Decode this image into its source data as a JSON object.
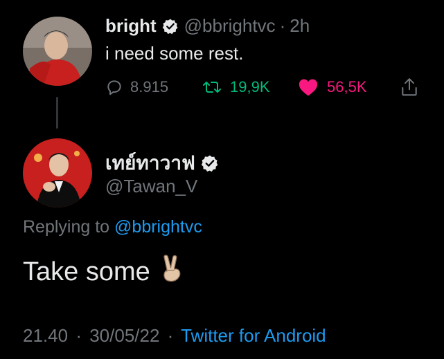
{
  "parent_tweet": {
    "display_name": "bright",
    "handle": "@bbrightvc",
    "separator": "·",
    "time": "2h",
    "text": "i need some rest.",
    "reply_count": "8.915",
    "retweet_count": "19,9K",
    "like_count": "56,5K",
    "avatar_icon": "user-avatar-photo"
  },
  "reply_tweet": {
    "display_name": "เทย์ทาวาฟ",
    "handle": "@Tawan_V",
    "replying_prefix": "Replying to",
    "replying_to": "@bbrightvc",
    "text": "Take some",
    "emoji": "✌🏼",
    "time": "21.40",
    "date_separator": "·",
    "date": "30/05/22",
    "source_separator": "·",
    "source": "Twitter for Android",
    "avatar_icon": "user-avatar-photo"
  },
  "colors": {
    "background": "#000000",
    "text": "#e7e9ea",
    "muted": "#71767b",
    "link": "#1d9bf0",
    "retweet": "#00ba7c",
    "like": "#f91880"
  }
}
